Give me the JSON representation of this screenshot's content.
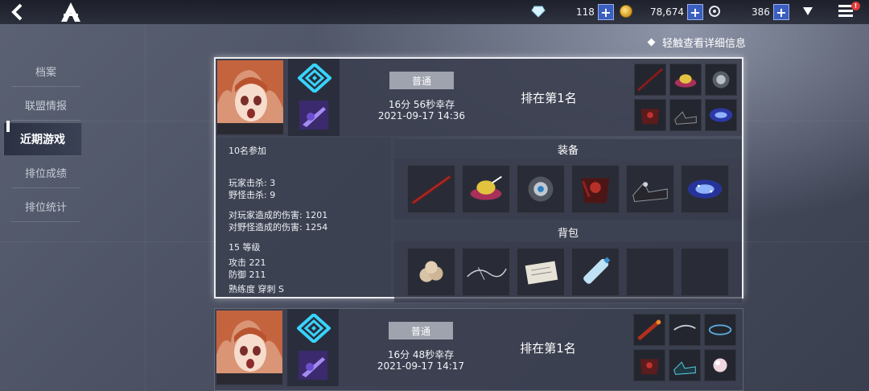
{
  "topbar": {
    "crystal_count": "118",
    "gold_count": "78,674",
    "ticket_count": "386",
    "menu_badge": "!"
  },
  "hint": "轻触查看详细信息",
  "sidebar": {
    "items": [
      {
        "label": "档案"
      },
      {
        "label": "联盟情报"
      },
      {
        "label": "近期游戏"
      },
      {
        "label": "排位成绩"
      },
      {
        "label": "排位统计"
      }
    ],
    "active_index": 2
  },
  "matches": [
    {
      "mode": "普通",
      "survival": "16分 56秒幸存",
      "datetime": "2021-09-17 14:36",
      "placement": "排在第1名",
      "equipment_mini": [
        "red-spear-icon",
        "feather-hat-icon",
        "armored-gauntlet-icon",
        "dark-armor-icon",
        "boots-icon",
        "galaxy-accessory-icon"
      ],
      "details": {
        "participants": "10名参加",
        "player_kills": "玩家击杀: 3",
        "monster_kills": "野怪击杀: 9",
        "player_damage": "对玩家造成的伤害: 1201",
        "monster_damage": "对野怪造成的伤害: 1254",
        "level": "15 等级",
        "attack": "攻击 221",
        "defense": "防御 211",
        "mastery": "熟练度  穿刺 S"
      },
      "equipment_title": "装备",
      "equipment": [
        "red-spear-icon",
        "feather-hat-icon",
        "armored-gauntlet-icon",
        "dark-armor-icon",
        "boots-icon",
        "galaxy-accessory-icon"
      ],
      "backpack_title": "背包",
      "backpack": [
        "garlic-icon",
        "wire-icon",
        "paper-icon",
        "water-bottle-icon",
        "",
        ""
      ]
    },
    {
      "mode": "普通",
      "survival": "16分 48秒幸存",
      "datetime": "2021-09-17 14:17",
      "placement": "排在第1名",
      "equipment_mini": [
        "flame-club-icon",
        "whip-icon",
        "bracelet-icon",
        "dark-armor-icon",
        "gem-boots-icon",
        "pearl-icon"
      ]
    }
  ],
  "colors": {
    "accent_blue": "#3a5fbf",
    "rank_cyan": "#38d4ff",
    "card_border": "#f5f6fa"
  }
}
